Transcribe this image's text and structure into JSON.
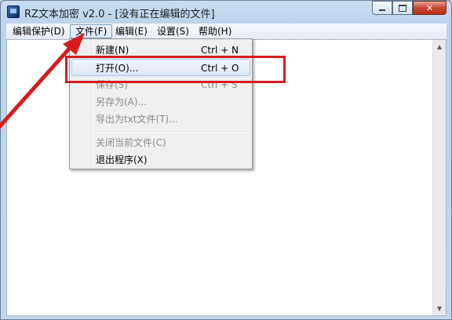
{
  "window": {
    "title": "RZ文本加密 v2.0 - [没有正在编辑的文件]",
    "close_glyph": "✕"
  },
  "menubar": {
    "items": [
      {
        "label": "编辑保护(D)"
      },
      {
        "label": "文件(F)"
      },
      {
        "label": "编辑(E)"
      },
      {
        "label": "设置(S)"
      },
      {
        "label": "帮助(H)"
      }
    ]
  },
  "file_menu": {
    "items": [
      {
        "label": "新建(N)",
        "shortcut": "Ctrl + N"
      },
      {
        "label": "打开(O)...",
        "shortcut": "Ctrl + O"
      },
      {
        "label": "保存(S)",
        "shortcut": "Ctrl + S"
      },
      {
        "label": "另存为(A)..."
      },
      {
        "label": "导出为txt文件(T)..."
      },
      {
        "label": "关闭当前文件(C)"
      },
      {
        "label": "退出程序(X)"
      }
    ]
  },
  "scrollbar": {
    "up_glyph": "▲",
    "down_glyph": "▼"
  },
  "colors": {
    "annotation_red": "#d61c1c",
    "menu_hover": "#dde9f7"
  },
  "icons": {
    "app": "app-icon",
    "annotation": "red-arrow-annotation"
  }
}
